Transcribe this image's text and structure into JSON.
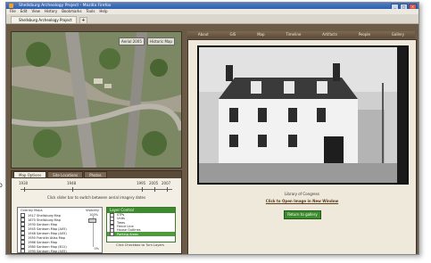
{
  "window": {
    "title": "Shellsburg Archeology Project - Mozilla Firefox"
  },
  "menu": [
    "File",
    "Edit",
    "View",
    "History",
    "Bookmarks",
    "Tools",
    "Help"
  ],
  "browser_tab": {
    "label": "Shellsburg Archeology Project",
    "new_tab": "+"
  },
  "aerial": {
    "ctl_left": "Aerial 2005",
    "ctl_right": "Historic Map"
  },
  "nav": [
    "About",
    "GIS",
    "Map",
    "Timeline",
    "Artifacts",
    "People",
    "Gallery"
  ],
  "left_panel": {
    "tabs": [
      "Map Options",
      "Site Locations",
      "Photos"
    ],
    "active_tab": 0,
    "timeline": {
      "labels": [
        "1930",
        "1948",
        "1995",
        "2005",
        "2007"
      ],
      "hint": "Click slider bar to switch between aerial imagery dates"
    },
    "overlay_header": "Overlay Maps",
    "visibility_header": "Visibility",
    "overlays": [
      "1917 Shellsburg Map",
      "1870 Shellsburg Map",
      "1930 Sanborn Map",
      "1945 Sanborn Map (A05)",
      "1948 Sanborn Map (A05)",
      "1950 Franklin Atlas Map",
      "1966 Sanborn Map",
      "1980 Sanborn Map (B11)",
      "1990 Sanborn Map (A05)",
      "Overlay Map Off"
    ],
    "visibility_top": "100%",
    "visibility_bottom": "0%",
    "layers_header": "Layer Control",
    "layers": [
      "STPs",
      "Units",
      "Trees",
      "Fence Line",
      "House Outlines",
      "Parking Areas"
    ],
    "layers_active": 5,
    "layers_tip": "Click Checkbox to Turn Layers"
  },
  "side_label": "o",
  "viewer": {
    "caption": "Library of Congress",
    "link": "Click to Open Image in New Window",
    "button": "Return to gallery"
  }
}
